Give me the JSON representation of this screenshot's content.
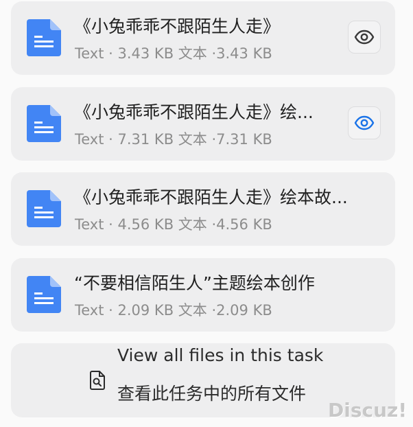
{
  "files": [
    {
      "title": "《小兔乖乖不跟陌生人走》",
      "meta": "Text · 3.43 KB  文本 ·3.43 KB",
      "preview_icon": "eye-icon",
      "preview_color": "#3a3a3a"
    },
    {
      "title": "《小兔乖乖不跟陌生人走》绘...",
      "meta": "Text · 7.31 KB  文本 ·7.31 KB",
      "preview_icon": "eye-icon",
      "preview_color": "#1a73e8"
    },
    {
      "title": "《小兔乖乖不跟陌生人走》绘本故...",
      "meta": "Text · 4.56 KB  文本 ·4.56 KB"
    },
    {
      "title": "“不要相信陌生人”主题绘本创作",
      "meta": "Text · 2.09 KB  文本 ·2.09 KB"
    }
  ],
  "view_all": {
    "label_en": "View all files in this task",
    "label_zh": "查看此任务中的所有文件",
    "icon": "file-search-icon"
  },
  "watermark": "Discuz!",
  "colors": {
    "doc_icon_blue": "#4285f4",
    "card_bg": "#eeeeef",
    "meta_gray": "#8c8c8c"
  }
}
